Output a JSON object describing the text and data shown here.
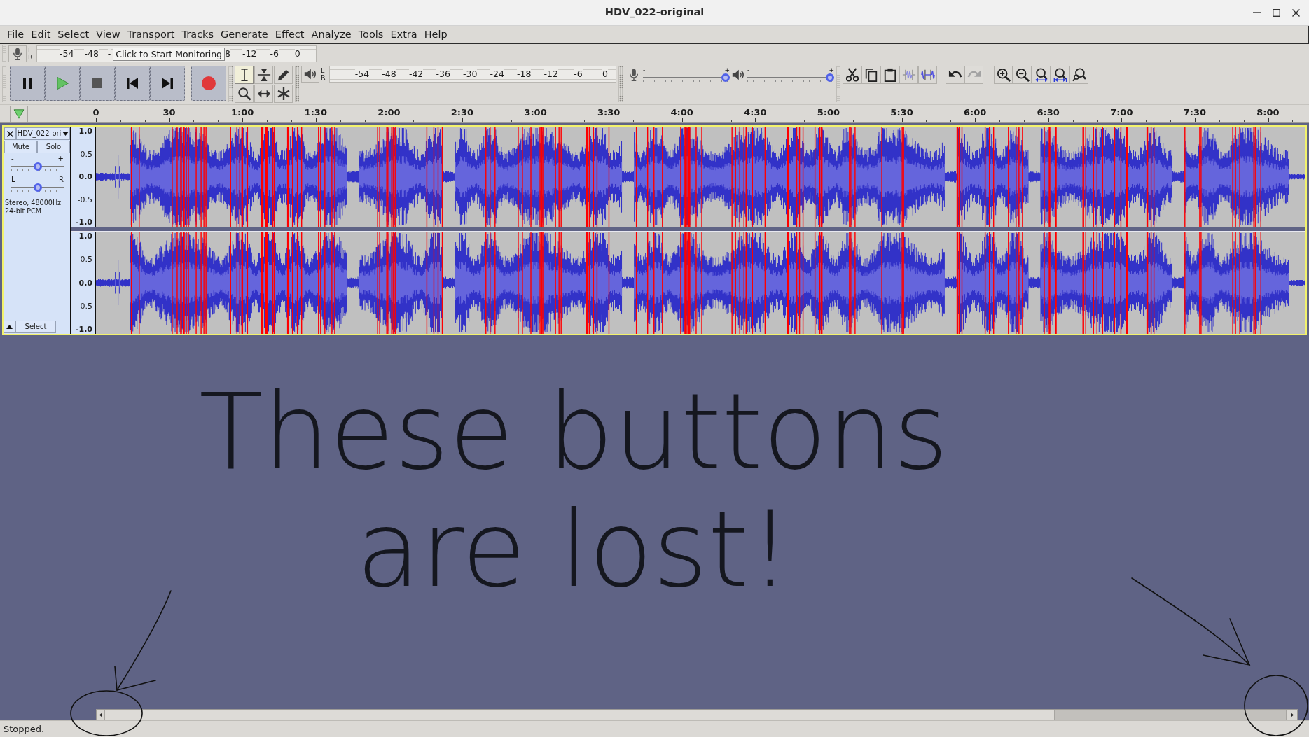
{
  "window": {
    "title": "HDV_022-original"
  },
  "menu": [
    "File",
    "Edit",
    "Select",
    "View",
    "Transport",
    "Tracks",
    "Generate",
    "Effect",
    "Analyze",
    "Tools",
    "Extra",
    "Help"
  ],
  "recording_meter": {
    "channels": [
      "L",
      "R"
    ],
    "labels_before": [
      "-54",
      "-48",
      "-"
    ],
    "tooltip": "Click to Start Monitoring",
    "labels_after": [
      "8",
      "-12",
      "-6",
      "0"
    ]
  },
  "transport": [
    {
      "kind": "pause"
    },
    {
      "kind": "play"
    },
    {
      "kind": "stop"
    },
    {
      "kind": "skip_start"
    },
    {
      "kind": "skip_end"
    },
    {
      "kind": "record"
    }
  ],
  "tools": [
    {
      "kind": "select",
      "selected": true
    },
    {
      "kind": "envelope",
      "selected": false
    },
    {
      "kind": "draw",
      "selected": false
    },
    {
      "kind": "zoom",
      "selected": false
    },
    {
      "kind": "time_shift",
      "selected": false
    },
    {
      "kind": "multi",
      "selected": false
    }
  ],
  "playback_meter": {
    "channels": [
      "L",
      "R"
    ],
    "labels": [
      "-54",
      "-48",
      "-42",
      "-36",
      "-30",
      "-24",
      "-18",
      "-12",
      "-6",
      "0"
    ]
  },
  "mixer": [
    {
      "kind": "recording",
      "min_label": "-",
      "max_label": "+",
      "level": 1
    },
    {
      "kind": "playback",
      "min_label": "-",
      "max_label": "+",
      "level": 1
    }
  ],
  "edit_buttons": [
    {
      "kind": "cut"
    },
    {
      "kind": "copy"
    },
    {
      "kind": "paste"
    },
    {
      "kind": "trim"
    },
    {
      "kind": "silence"
    }
  ],
  "history_buttons": [
    {
      "kind": "undo",
      "disabled": false
    },
    {
      "kind": "redo",
      "disabled": true
    }
  ],
  "zoom_buttons": [
    {
      "kind": "zoom_in"
    },
    {
      "kind": "zoom_out"
    },
    {
      "kind": "fit_selection"
    },
    {
      "kind": "fit_project"
    },
    {
      "kind": "zoom_toggle"
    }
  ],
  "timeline": {
    "labels": [
      "0",
      "30",
      "1:00",
      "1:30",
      "2:00",
      "2:30",
      "3:00",
      "3:30",
      "4:00",
      "4:30",
      "5:00",
      "5:30",
      "6:00",
      "6:30",
      "7:00",
      "7:30",
      "8:00"
    ]
  },
  "track": {
    "name": "HDV_022-ori",
    "focused": true,
    "buttons": [
      "Mute",
      "Solo"
    ],
    "gain": {
      "min_label": "-",
      "max_label": "+",
      "level": 0.5
    },
    "pan": {
      "min_label": "L",
      "max_label": "R",
      "level": 0.5
    },
    "info": [
      "Stereo, 48000Hz",
      "24-bit PCM"
    ],
    "select_button": "Select",
    "channels": [
      {
        "ruler": [
          "1.0",
          "0.5",
          "0.0",
          "-0.5",
          "-1.0"
        ]
      },
      {
        "ruler": [
          "1.0",
          "0.5",
          "0.0",
          "-0.5",
          "-1.0"
        ]
      }
    ]
  },
  "annotation": {
    "text": "These buttons are lost!"
  },
  "status_bar": {
    "text": "Stopped."
  }
}
